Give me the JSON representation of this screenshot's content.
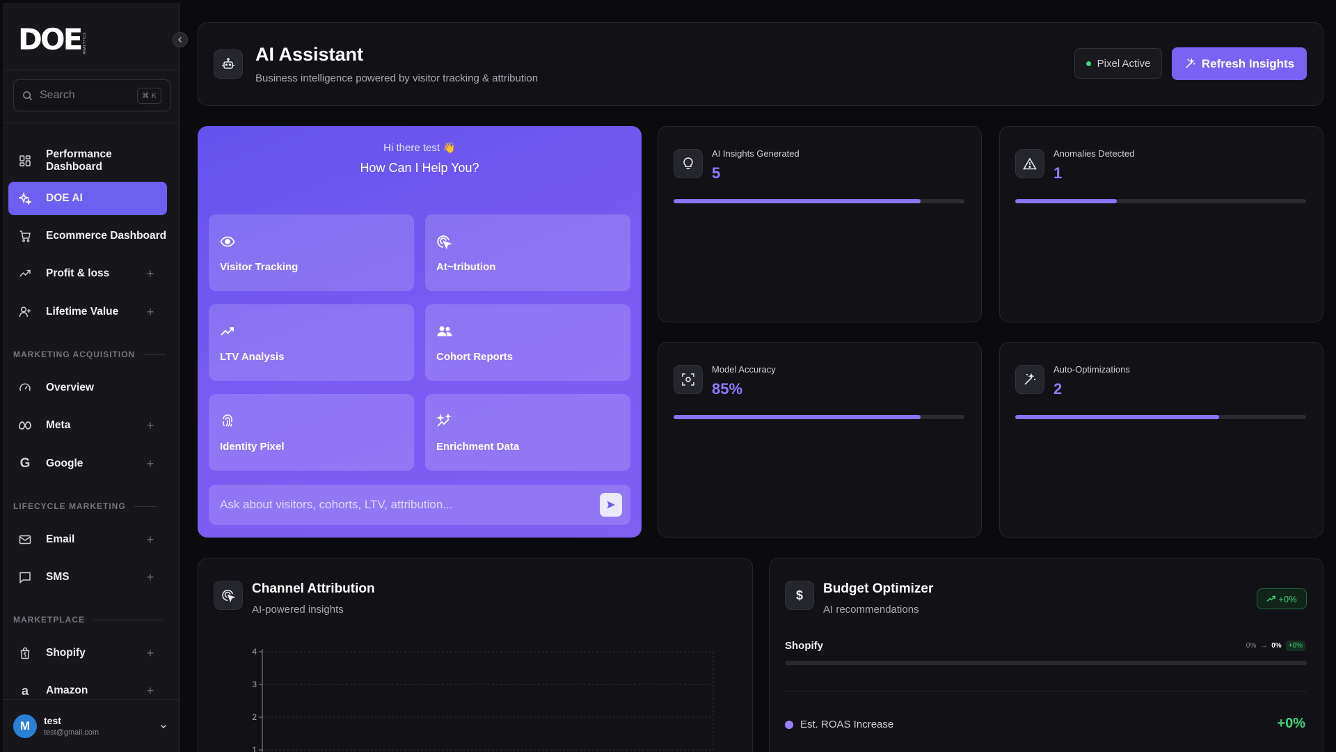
{
  "brand": {
    "logo": "DOE",
    "logo_sub": "ANALYTICS"
  },
  "search": {
    "placeholder": "Search",
    "shortcut": "⌘ K"
  },
  "nav": {
    "performance": "Performance Dashboard",
    "doe_ai": "DOE AI",
    "ecommerce": "Ecommerce Dashboard",
    "profit": "Profit & loss",
    "ltv": "Lifetime Value",
    "section_marketing": "MARKETING ACQUISITION",
    "overview": "Overview",
    "meta": "Meta",
    "google": "Google",
    "section_lifecycle": "LIFECYCLE MARKETING",
    "email": "Email",
    "sms": "SMS",
    "section_marketplace": "MARKETPLACE",
    "shopify": "Shopify",
    "amazon": "Amazon"
  },
  "user": {
    "initial": "M",
    "name": "test",
    "email": "test@gmail.com"
  },
  "header": {
    "title": "AI Assistant",
    "subtitle": "Business intelligence powered by visitor tracking & attribution",
    "pixel_status": "Pixel Active",
    "refresh_label": "Refresh Insights"
  },
  "assistant": {
    "greeting": "Hi there test 👋",
    "prompt": "How Can I Help You?",
    "tiles": [
      "Visitor Tracking",
      "At~tribution",
      "LTV Analysis",
      "Cohort Reports",
      "Identity Pixel",
      "Enrichment Data"
    ],
    "input_placeholder": "Ask about visitors, cohorts, LTV, attribution..."
  },
  "stats": [
    {
      "label": "AI Insights Generated",
      "value": "5",
      "progress": 0.85
    },
    {
      "label": "Anomalies Detected",
      "value": "1",
      "progress": 0.35
    },
    {
      "label": "Model Accuracy",
      "value": "85%",
      "progress": 0.85
    },
    {
      "label": "Auto-Optimizations",
      "value": "2",
      "progress": 0.7
    }
  ],
  "channel": {
    "title": "Channel Attribution",
    "subtitle": "AI-powered insights",
    "y_ticks": [
      "4",
      "3",
      "2",
      "1"
    ]
  },
  "budget": {
    "title": "Budget Optimizer",
    "subtitle": "AI recommendations",
    "trend": "+0%",
    "channel": "Shopify",
    "pct_from": "0%",
    "pct_arrow": "→",
    "pct_to": "0%",
    "pct_delta": "+0%",
    "roas_label": "Est. ROAS Increase",
    "roas_value": "+0%"
  },
  "colors": {
    "accent": "#7a62f5",
    "stat_value": "#8f7bff",
    "positive": "#3ed47a"
  }
}
